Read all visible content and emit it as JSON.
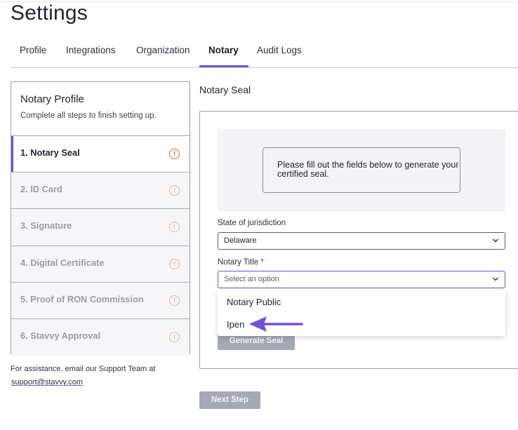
{
  "page": {
    "title": "Settings"
  },
  "tabs": [
    {
      "label": "Profile"
    },
    {
      "label": "Integrations"
    },
    {
      "label": "Organization"
    },
    {
      "label": "Notary"
    },
    {
      "label": "Audit Logs"
    }
  ],
  "active_tab": "Notary",
  "notary_profile": {
    "title": "Notary Profile",
    "subtitle": "Complete all steps to finish setting up.",
    "steps": [
      {
        "label": "1. Notary Seal",
        "status": "incomplete",
        "active": true
      },
      {
        "label": "2. ID Card",
        "status": "incomplete"
      },
      {
        "label": "3. Signature",
        "status": "incomplete"
      },
      {
        "label": "4. Digital Certificate",
        "status": "incomplete"
      },
      {
        "label": "5. Proof of RON Commission",
        "status": "incomplete"
      },
      {
        "label": "6. Stavvy Approval",
        "status": "incomplete"
      }
    ],
    "warning_glyph": "!"
  },
  "assist": {
    "text": "For assistance, email our Support Team at",
    "email": "support@stavvy.com"
  },
  "notary_seal": {
    "section_title": "Notary Seal",
    "preview_message": "Please fill out the fields below to generate your certified seal.",
    "state_label": "State of jurisdiction",
    "state_value": "Delaware",
    "title_label": "Notary Title",
    "required_mark": "*",
    "title_placeholder": "Select an option",
    "options": [
      "Notary Public",
      "Ipen"
    ],
    "generate_label": "Generate Seal"
  },
  "next_label": "Next Step",
  "icons": {
    "warning": "exclamation-circle-icon",
    "chevron": "chevron-down-icon",
    "pointer": "arrow-left-icon"
  },
  "colors": {
    "accent": "#7252d4",
    "warning_active": "#d9682a",
    "warning_inactive": "#f0b48a",
    "required": "#c82436",
    "disabled_button": "#a5a9b6"
  }
}
